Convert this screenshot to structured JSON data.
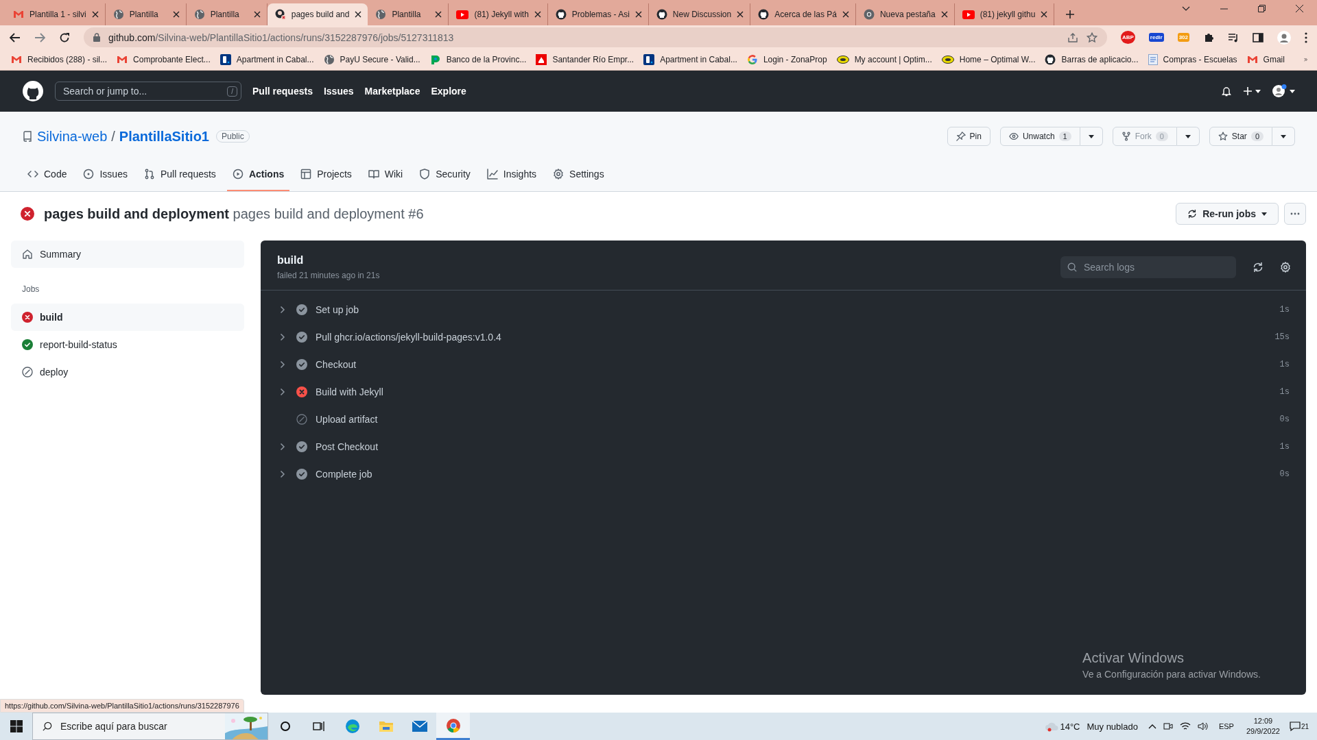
{
  "browser": {
    "tabs": [
      {
        "title": "Plantilla 1 - silvi",
        "kind": "gmail",
        "selected": false
      },
      {
        "title": "Plantilla",
        "kind": "globe",
        "selected": false
      },
      {
        "title": "Plantilla",
        "kind": "globe",
        "selected": false
      },
      {
        "title": "pages build and",
        "kind": "github-fail",
        "selected": true
      },
      {
        "title": "Plantilla",
        "kind": "globe",
        "selected": false
      },
      {
        "title": "(81) Jekyll with",
        "kind": "youtube",
        "selected": false
      },
      {
        "title": "Problemas - Asi",
        "kind": "github",
        "selected": false
      },
      {
        "title": "New Discussion",
        "kind": "github",
        "selected": false
      },
      {
        "title": "Acerca de las Pá",
        "kind": "github",
        "selected": false
      },
      {
        "title": "Nueva pestaña",
        "kind": "chrome",
        "selected": false
      },
      {
        "title": "(81) jekyll githu",
        "kind": "youtube",
        "selected": false
      }
    ],
    "url_host": "github.com",
    "url_path": "/Silvina-web/PlantillaSitio1/actions/runs/3152287976/jobs/5127311813",
    "extensions": [
      {
        "label": "ABP",
        "kind": "abp"
      },
      {
        "label": "redir",
        "kind": "redir"
      },
      {
        "label": "302",
        "kind": "badge302"
      }
    ],
    "bookmarks": [
      {
        "label": "Recibidos (288) - sil...",
        "kind": "gmail"
      },
      {
        "label": "Comprobante Elect...",
        "kind": "gmail"
      },
      {
        "label": "Apartment in Cabal...",
        "kind": "booking"
      },
      {
        "label": "PayU Secure - Valid...",
        "kind": "globe"
      },
      {
        "label": "Banco de la Provinc...",
        "kind": "bank"
      },
      {
        "label": "Santander Río Empr...",
        "kind": "santander"
      },
      {
        "label": "Apartment in Cabal...",
        "kind": "booking"
      },
      {
        "label": "Login - ZonaProp",
        "kind": "google"
      },
      {
        "label": "My account | Optim...",
        "kind": "ow"
      },
      {
        "label": "Home – Optimal W...",
        "kind": "ow"
      },
      {
        "label": "Barras de aplicacio...",
        "kind": "github"
      },
      {
        "label": "Compras - Escuelas",
        "kind": "doc"
      },
      {
        "label": "Gmail",
        "kind": "gmail"
      }
    ],
    "status_url": "https://github.com/Silvina-web/PlantillaSitio1/actions/runs/3152287976"
  },
  "github": {
    "search_placeholder": "Search or jump to...",
    "search_key": "/",
    "nav": [
      "Pull requests",
      "Issues",
      "Marketplace",
      "Explore"
    ],
    "owner": "Silvina-web",
    "separator": "/",
    "repo": "PlantillaSitio1",
    "visibility": "Public",
    "repo_buttons": [
      {
        "label": "Pin",
        "kind": "pin",
        "dropdown": false,
        "disabled": false
      },
      {
        "label": "Unwatch",
        "kind": "eye",
        "count": "1",
        "dropdown": true,
        "disabled": false
      },
      {
        "label": "Fork",
        "kind": "fork",
        "count": "0",
        "dropdown": true,
        "disabled": true
      },
      {
        "label": "Star",
        "kind": "star",
        "count": "0",
        "dropdown": true,
        "disabled": false
      }
    ],
    "repo_tabs": [
      {
        "label": "Code",
        "kind": "code",
        "selected": false
      },
      {
        "label": "Issues",
        "kind": "issue",
        "selected": false
      },
      {
        "label": "Pull requests",
        "kind": "pr",
        "selected": false
      },
      {
        "label": "Actions",
        "kind": "play",
        "selected": true
      },
      {
        "label": "Projects",
        "kind": "table",
        "selected": false
      },
      {
        "label": "Wiki",
        "kind": "book",
        "selected": false
      },
      {
        "label": "Security",
        "kind": "shield",
        "selected": false
      },
      {
        "label": "Insights",
        "kind": "graph",
        "selected": false
      },
      {
        "label": "Settings",
        "kind": "gear",
        "selected": false
      }
    ],
    "run": {
      "kind": "failure",
      "title": "pages build and deployment",
      "subtitle": "pages build and deployment #6",
      "rerun": "Re-run jobs"
    },
    "summary": "Summary",
    "jobs_heading": "Jobs",
    "jobs": [
      {
        "name": "build",
        "kind": "failure",
        "selected": true
      },
      {
        "name": "report-build-status",
        "kind": "success",
        "selected": false
      },
      {
        "name": "deploy",
        "kind": "skipped",
        "selected": false
      }
    ],
    "job": {
      "name": "build",
      "meta": "failed 21 minutes ago in 21s",
      "search_placeholder": "Search logs",
      "steps": [
        {
          "name": "Set up job",
          "kind": "success",
          "expandable": true,
          "duration": "1s"
        },
        {
          "name": "Pull ghcr.io/actions/jekyll-build-pages:v1.0.4",
          "kind": "success",
          "expandable": true,
          "duration": "15s"
        },
        {
          "name": "Checkout",
          "kind": "success",
          "expandable": true,
          "duration": "1s"
        },
        {
          "name": "Build with Jekyll",
          "kind": "failure",
          "expandable": true,
          "duration": "1s"
        },
        {
          "name": "Upload artifact",
          "kind": "skipped",
          "expandable": false,
          "duration": "0s"
        },
        {
          "name": "Post Checkout",
          "kind": "success",
          "expandable": true,
          "duration": "1s"
        },
        {
          "name": "Complete job",
          "kind": "success",
          "expandable": true,
          "duration": "0s"
        }
      ]
    }
  },
  "activation": {
    "title": "Activar Windows",
    "text": "Ve a Configuración para activar Windows."
  },
  "taskbar": {
    "search_placeholder": "Escribe aquí para buscar",
    "apps": [
      {
        "kind": "cortana"
      },
      {
        "kind": "taskview"
      },
      {
        "kind": "edge"
      },
      {
        "kind": "explorer"
      },
      {
        "kind": "mail"
      },
      {
        "kind": "chrome",
        "selected": true
      }
    ],
    "weather": "14°C",
    "weather_text": "Muy nublado",
    "language": "ESP",
    "time": "12:09",
    "date": "29/9/2022",
    "notifications": "21"
  }
}
